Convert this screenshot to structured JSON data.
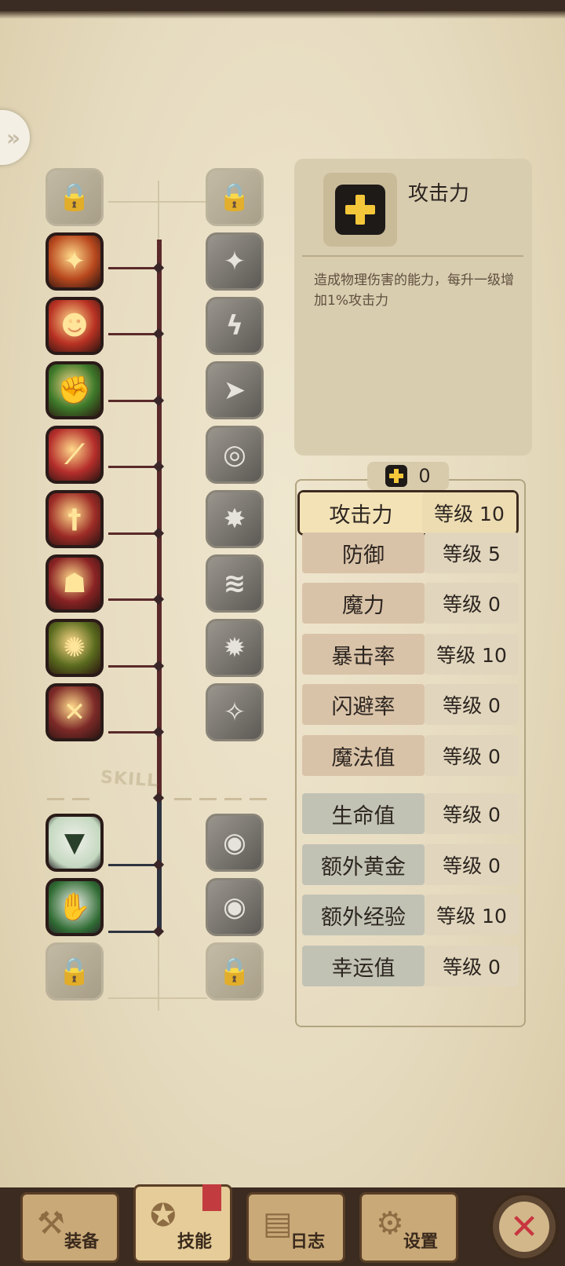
{
  "tree": {
    "skill_label": "SKILL",
    "left_icons": [
      {
        "icon": "lock-icon",
        "state": "locked",
        "color": "#a09883"
      },
      {
        "icon": "fire-attack-icon",
        "state": "active",
        "color": "#b8481e"
      },
      {
        "icon": "rage-face-icon",
        "state": "active",
        "color": "#b93223"
      },
      {
        "icon": "muscle-arm-icon",
        "state": "active",
        "color": "#3e7a2a"
      },
      {
        "icon": "blade-slash-icon",
        "state": "active",
        "color": "#b52e2b"
      },
      {
        "icon": "dagger-icon",
        "state": "active",
        "color": "#9c2b26"
      },
      {
        "icon": "shadow-assassin-icon",
        "state": "active",
        "color": "#8a2324"
      },
      {
        "icon": "golden-aura-icon",
        "state": "active",
        "color": "#5a6b1e"
      },
      {
        "icon": "crossed-swords-icon",
        "state": "active",
        "color": "#7d2a28"
      },
      {
        "icon": "red-chest-icon",
        "state": "active-lower",
        "color": "#c4d8c0"
      },
      {
        "icon": "green-chest-icon",
        "state": "active-lower",
        "color": "#2f6b33"
      },
      {
        "icon": "lock-icon",
        "state": "locked",
        "color": "#a09883"
      }
    ],
    "right_icons": [
      {
        "icon": "shield-lock-icon",
        "state": "locked"
      },
      {
        "icon": "power-strike-icon",
        "state": "gray"
      },
      {
        "icon": "lightning-icon",
        "state": "gray"
      },
      {
        "icon": "dash-icon",
        "state": "gray"
      },
      {
        "icon": "whirlwind-icon",
        "state": "gray"
      },
      {
        "icon": "burst-icon",
        "state": "gray"
      },
      {
        "icon": "swipe-icon",
        "state": "gray"
      },
      {
        "icon": "explosion-icon",
        "state": "gray"
      },
      {
        "icon": "sparkle-spirit-icon",
        "state": "gray"
      },
      {
        "icon": "eye-chest-icon",
        "state": "gray"
      },
      {
        "icon": "eye-chest-icon",
        "state": "gray"
      },
      {
        "icon": "lock-icon",
        "state": "locked"
      }
    ]
  },
  "info": {
    "title": "攻击力",
    "description": "造成物理伤害的能力，每升一级增加1%攻击力"
  },
  "points": {
    "value": "0"
  },
  "stats": [
    {
      "name": "攻击力",
      "level": "等级 10",
      "group": "selected"
    },
    {
      "name": "防御",
      "level": "等级 5",
      "group": "red"
    },
    {
      "name": "魔力",
      "level": "等级 0",
      "group": "red"
    },
    {
      "name": "暴击率",
      "level": "等级 10",
      "group": "red"
    },
    {
      "name": "闪避率",
      "level": "等级 0",
      "group": "red"
    },
    {
      "name": "魔法值",
      "level": "等级 0",
      "group": "red"
    },
    {
      "name": "生命值",
      "level": "等级 0",
      "group": "blue"
    },
    {
      "name": "额外黄金",
      "level": "等级 0",
      "group": "blue"
    },
    {
      "name": "额外经验",
      "level": "等级 10",
      "group": "blue"
    },
    {
      "name": "幸运值",
      "level": "等级 0",
      "group": "blue"
    }
  ],
  "nav": {
    "tabs": [
      {
        "label": "装备",
        "icon": "axe-icon"
      },
      {
        "label": "技能",
        "icon": "skill-icon",
        "active": true
      },
      {
        "label": "日志",
        "icon": "journal-icon"
      },
      {
        "label": "设置",
        "icon": "gear-icon"
      }
    ],
    "close_icon": "close-icon"
  },
  "colors": {
    "accent_gold": "#f4c73a",
    "close_red": "#c8353f",
    "tree_line_red": "#5a2a2a",
    "tree_line_blue": "#2e3340"
  }
}
